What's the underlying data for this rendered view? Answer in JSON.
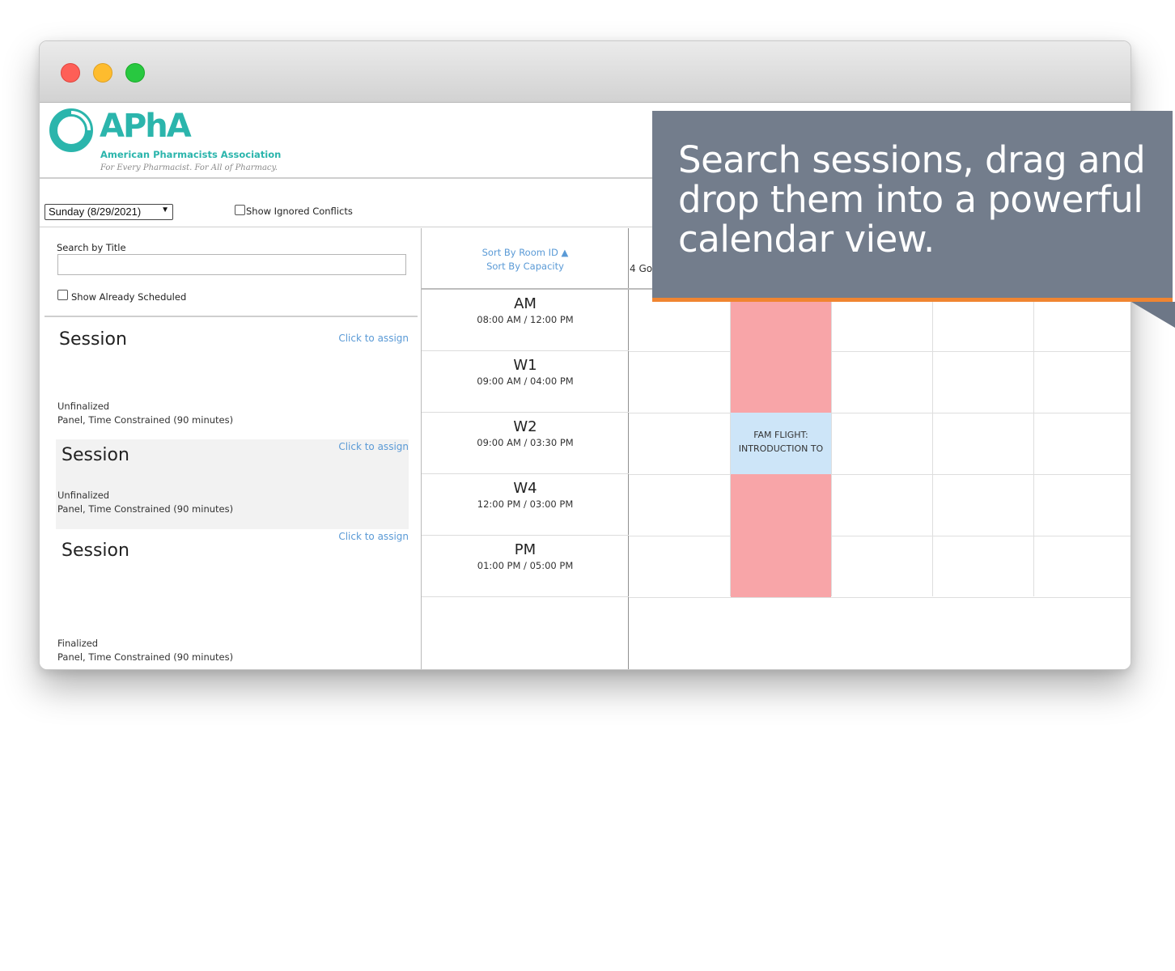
{
  "window": {
    "controls": [
      "close",
      "minimize",
      "zoom"
    ]
  },
  "header": {
    "logo_word": "APhA",
    "logo_name": "American Pharmacists Association",
    "logo_tagline": "For Every Pharmacist. For All of Pharmacy.",
    "brand_color": "#2bb5ac"
  },
  "toolbar": {
    "day_select": "Sunday (8/29/2021)",
    "show_ignored_conflicts": "Show Ignored Conflicts"
  },
  "search": {
    "label": "Search by Title",
    "value": "",
    "show_already_scheduled": "Show Already Scheduled"
  },
  "sessions": [
    {
      "title": "Session",
      "assign": "Click to assign",
      "status": "Unfinalized",
      "type": "Panel, Time Constrained (90 minutes)"
    },
    {
      "title": "Session",
      "assign": "Click to assign",
      "status": "Unfinalized",
      "type": "Panel, Time Constrained (90 minutes)"
    },
    {
      "title": "Session",
      "assign": "Click to assign",
      "status": "Finalized",
      "type": "Panel, Time Constrained (90 minutes)"
    }
  ],
  "rooms": {
    "sort_by_room": "Sort By Room ID ▲",
    "sort_by_capacity": "Sort By Capacity",
    "column_header": "4 Go",
    "slots": [
      {
        "name": "AM",
        "time": "08:00 AM / 12:00 PM"
      },
      {
        "name": "W1",
        "time": "09:00 AM / 04:00 PM"
      },
      {
        "name": "W2",
        "time": "09:00 AM / 03:30 PM"
      },
      {
        "name": "W4",
        "time": "12:00 PM / 03:00 PM"
      },
      {
        "name": "PM",
        "time": "01:00 PM / 05:00 PM"
      }
    ]
  },
  "calendar": {
    "booked_line1": "FAM FLIGHT:",
    "booked_line2": "INTRODUCTION TO",
    "conflict_color": "#f8a5a8",
    "booked_color": "#cde5f8"
  },
  "callout": {
    "text": "Search sessions, drag and drop them into a powerful calendar view.",
    "accent_color": "#f08531"
  }
}
